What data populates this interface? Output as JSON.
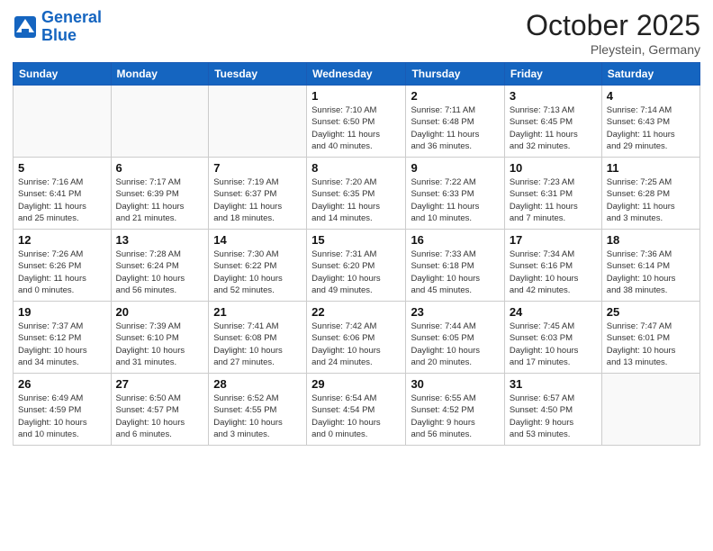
{
  "header": {
    "logo_line1": "General",
    "logo_line2": "Blue",
    "month": "October 2025",
    "location": "Pleystein, Germany"
  },
  "weekdays": [
    "Sunday",
    "Monday",
    "Tuesday",
    "Wednesday",
    "Thursday",
    "Friday",
    "Saturday"
  ],
  "weeks": [
    [
      {
        "day": "",
        "info": ""
      },
      {
        "day": "",
        "info": ""
      },
      {
        "day": "",
        "info": ""
      },
      {
        "day": "1",
        "info": "Sunrise: 7:10 AM\nSunset: 6:50 PM\nDaylight: 11 hours\nand 40 minutes."
      },
      {
        "day": "2",
        "info": "Sunrise: 7:11 AM\nSunset: 6:48 PM\nDaylight: 11 hours\nand 36 minutes."
      },
      {
        "day": "3",
        "info": "Sunrise: 7:13 AM\nSunset: 6:45 PM\nDaylight: 11 hours\nand 32 minutes."
      },
      {
        "day": "4",
        "info": "Sunrise: 7:14 AM\nSunset: 6:43 PM\nDaylight: 11 hours\nand 29 minutes."
      }
    ],
    [
      {
        "day": "5",
        "info": "Sunrise: 7:16 AM\nSunset: 6:41 PM\nDaylight: 11 hours\nand 25 minutes."
      },
      {
        "day": "6",
        "info": "Sunrise: 7:17 AM\nSunset: 6:39 PM\nDaylight: 11 hours\nand 21 minutes."
      },
      {
        "day": "7",
        "info": "Sunrise: 7:19 AM\nSunset: 6:37 PM\nDaylight: 11 hours\nand 18 minutes."
      },
      {
        "day": "8",
        "info": "Sunrise: 7:20 AM\nSunset: 6:35 PM\nDaylight: 11 hours\nand 14 minutes."
      },
      {
        "day": "9",
        "info": "Sunrise: 7:22 AM\nSunset: 6:33 PM\nDaylight: 11 hours\nand 10 minutes."
      },
      {
        "day": "10",
        "info": "Sunrise: 7:23 AM\nSunset: 6:31 PM\nDaylight: 11 hours\nand 7 minutes."
      },
      {
        "day": "11",
        "info": "Sunrise: 7:25 AM\nSunset: 6:28 PM\nDaylight: 11 hours\nand 3 minutes."
      }
    ],
    [
      {
        "day": "12",
        "info": "Sunrise: 7:26 AM\nSunset: 6:26 PM\nDaylight: 11 hours\nand 0 minutes."
      },
      {
        "day": "13",
        "info": "Sunrise: 7:28 AM\nSunset: 6:24 PM\nDaylight: 10 hours\nand 56 minutes."
      },
      {
        "day": "14",
        "info": "Sunrise: 7:30 AM\nSunset: 6:22 PM\nDaylight: 10 hours\nand 52 minutes."
      },
      {
        "day": "15",
        "info": "Sunrise: 7:31 AM\nSunset: 6:20 PM\nDaylight: 10 hours\nand 49 minutes."
      },
      {
        "day": "16",
        "info": "Sunrise: 7:33 AM\nSunset: 6:18 PM\nDaylight: 10 hours\nand 45 minutes."
      },
      {
        "day": "17",
        "info": "Sunrise: 7:34 AM\nSunset: 6:16 PM\nDaylight: 10 hours\nand 42 minutes."
      },
      {
        "day": "18",
        "info": "Sunrise: 7:36 AM\nSunset: 6:14 PM\nDaylight: 10 hours\nand 38 minutes."
      }
    ],
    [
      {
        "day": "19",
        "info": "Sunrise: 7:37 AM\nSunset: 6:12 PM\nDaylight: 10 hours\nand 34 minutes."
      },
      {
        "day": "20",
        "info": "Sunrise: 7:39 AM\nSunset: 6:10 PM\nDaylight: 10 hours\nand 31 minutes."
      },
      {
        "day": "21",
        "info": "Sunrise: 7:41 AM\nSunset: 6:08 PM\nDaylight: 10 hours\nand 27 minutes."
      },
      {
        "day": "22",
        "info": "Sunrise: 7:42 AM\nSunset: 6:06 PM\nDaylight: 10 hours\nand 24 minutes."
      },
      {
        "day": "23",
        "info": "Sunrise: 7:44 AM\nSunset: 6:05 PM\nDaylight: 10 hours\nand 20 minutes."
      },
      {
        "day": "24",
        "info": "Sunrise: 7:45 AM\nSunset: 6:03 PM\nDaylight: 10 hours\nand 17 minutes."
      },
      {
        "day": "25",
        "info": "Sunrise: 7:47 AM\nSunset: 6:01 PM\nDaylight: 10 hours\nand 13 minutes."
      }
    ],
    [
      {
        "day": "26",
        "info": "Sunrise: 6:49 AM\nSunset: 4:59 PM\nDaylight: 10 hours\nand 10 minutes."
      },
      {
        "day": "27",
        "info": "Sunrise: 6:50 AM\nSunset: 4:57 PM\nDaylight: 10 hours\nand 6 minutes."
      },
      {
        "day": "28",
        "info": "Sunrise: 6:52 AM\nSunset: 4:55 PM\nDaylight: 10 hours\nand 3 minutes."
      },
      {
        "day": "29",
        "info": "Sunrise: 6:54 AM\nSunset: 4:54 PM\nDaylight: 10 hours\nand 0 minutes."
      },
      {
        "day": "30",
        "info": "Sunrise: 6:55 AM\nSunset: 4:52 PM\nDaylight: 9 hours\nand 56 minutes."
      },
      {
        "day": "31",
        "info": "Sunrise: 6:57 AM\nSunset: 4:50 PM\nDaylight: 9 hours\nand 53 minutes."
      },
      {
        "day": "",
        "info": ""
      }
    ]
  ]
}
